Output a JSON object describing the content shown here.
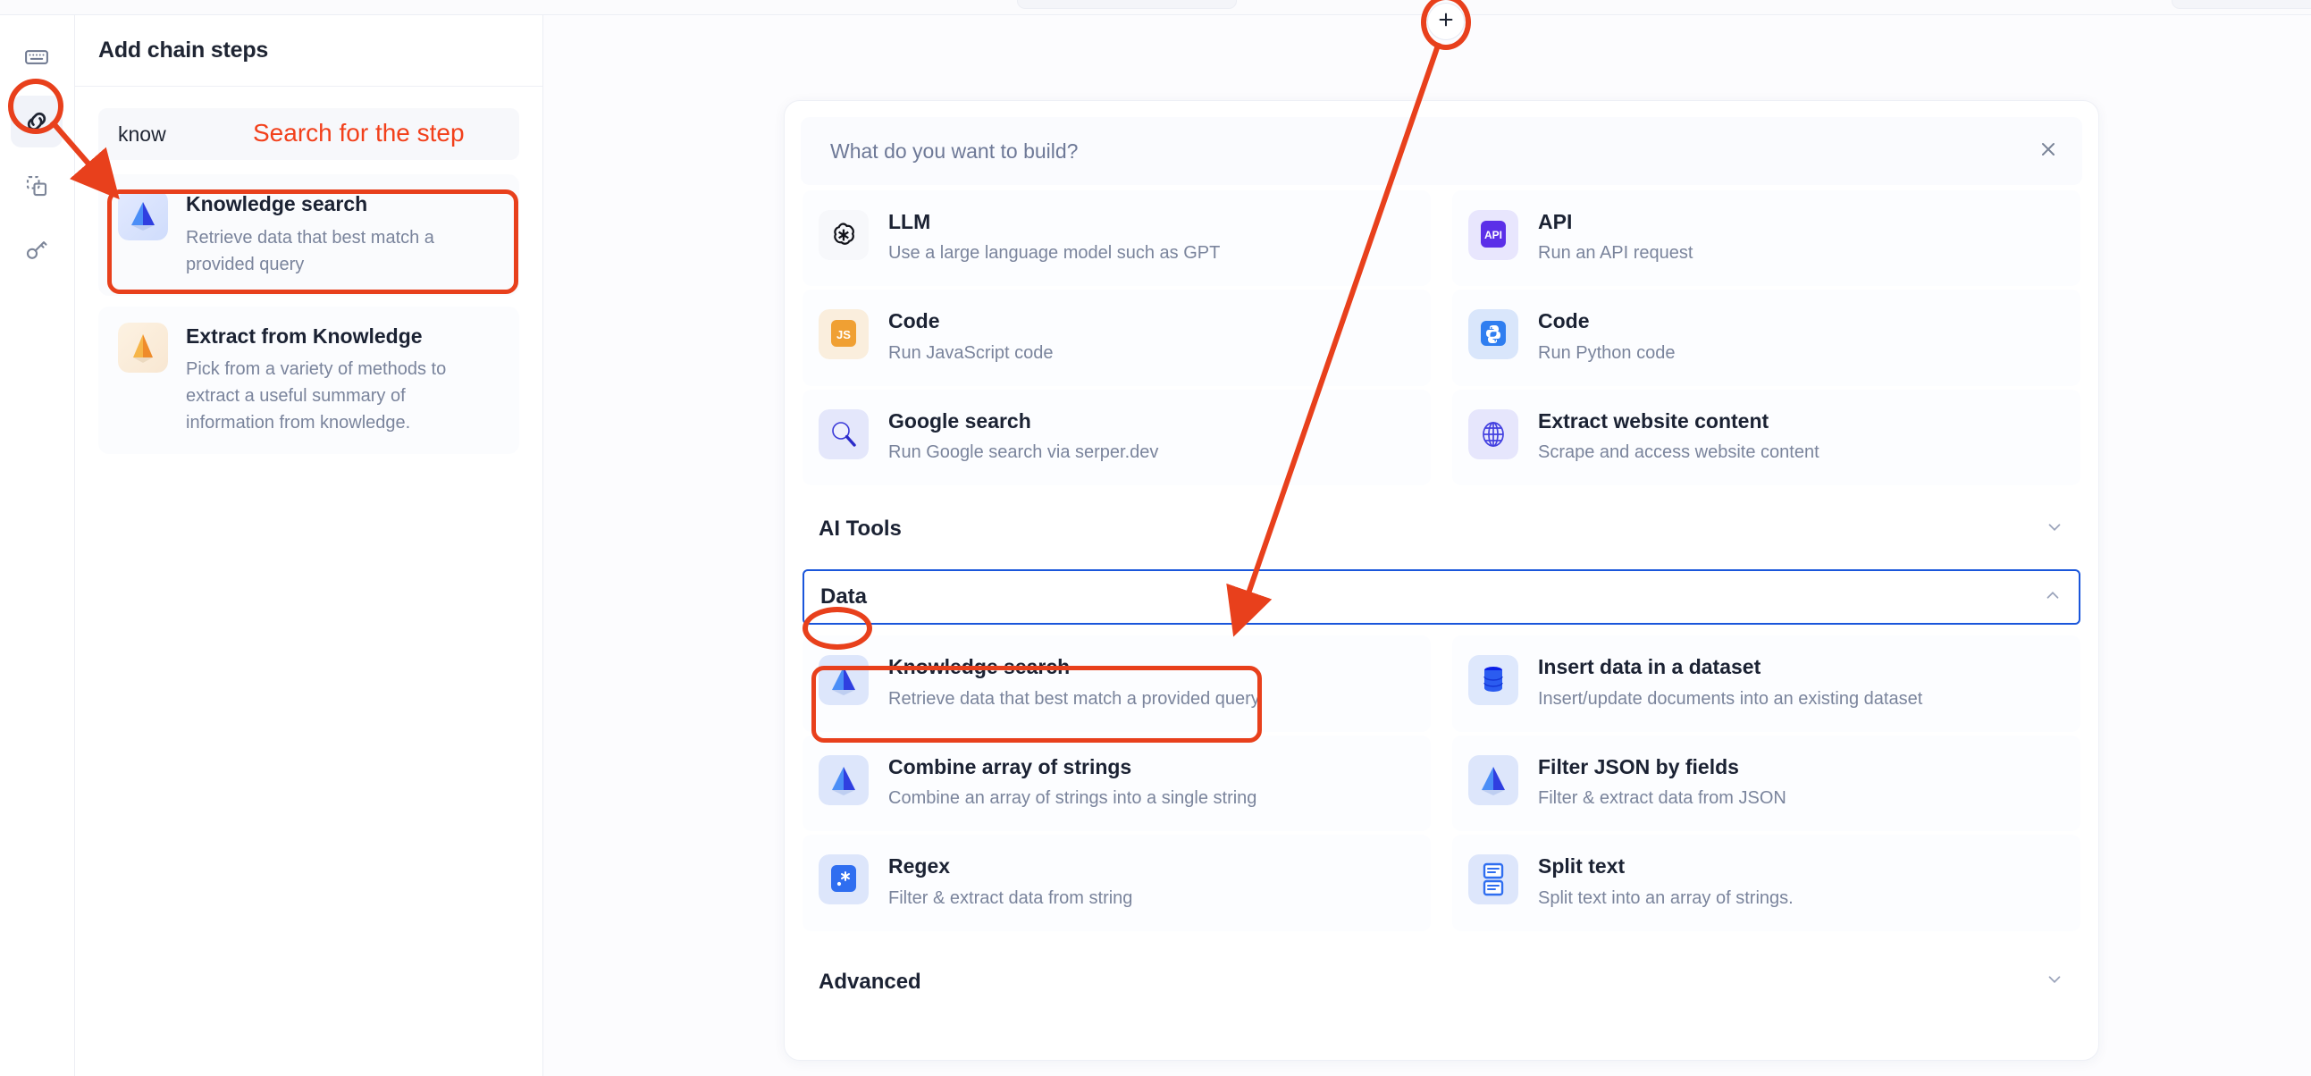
{
  "app": {
    "accent_red": "#e8401c",
    "accent_blue": "#1a56db"
  },
  "left_panel": {
    "title": "Add chain steps",
    "search": {
      "value": "know",
      "placeholder": "Search for the step"
    },
    "results": [
      {
        "title": "Knowledge search",
        "desc": "Retrieve data that best match a provided query",
        "icon": "blue-pyramid-icon",
        "highlighted": true
      },
      {
        "title": "Extract from Knowledge",
        "desc": "Pick from a variety of methods to extract a useful summary of information from knowledge.",
        "icon": "orange-pyramid-icon",
        "highlighted": false
      }
    ]
  },
  "rail": {
    "items": [
      {
        "name": "keyboard-input-icon",
        "active": false
      },
      {
        "name": "chain-link-icon",
        "active": true
      },
      {
        "name": "duplicate-frame-icon",
        "active": false
      },
      {
        "name": "key-icon",
        "active": false
      }
    ]
  },
  "modal": {
    "heading": "What do you want to build?",
    "close_label": "✕",
    "top_tiles": [
      {
        "title": "LLM",
        "desc": "Use a large language model such as GPT",
        "icon": "openai-icon"
      },
      {
        "title": "API",
        "desc": "Run an API request",
        "icon": "api-icon"
      },
      {
        "title": "Code",
        "desc": "Run JavaScript code",
        "icon": "javascript-icon"
      },
      {
        "title": "Code",
        "desc": "Run Python code",
        "icon": "python-icon"
      },
      {
        "title": "Google search",
        "desc": "Run Google search via serper.dev",
        "icon": "magnifier-icon"
      },
      {
        "title": "Extract website content",
        "desc": "Scrape and access website content",
        "icon": "globe-icon"
      }
    ],
    "sections": [
      {
        "title": "AI Tools",
        "expanded": false,
        "chevron": "chevron-down-icon"
      },
      {
        "title": "Data",
        "expanded": true,
        "chevron": "chevron-up-icon"
      },
      {
        "title": "Advanced",
        "expanded": false,
        "chevron": "chevron-down-icon"
      }
    ],
    "data_tiles": [
      {
        "title": "Knowledge search",
        "desc": "Retrieve data that best match a provided query",
        "icon": "blue-pyramid-icon",
        "highlighted": true
      },
      {
        "title": "Insert data in a dataset",
        "desc": "Insert/update documents into an existing dataset",
        "icon": "database-icon",
        "highlighted": false
      },
      {
        "title": "Combine array of strings",
        "desc": "Combine an array of strings into a single string",
        "icon": "blue-pyramid-icon",
        "highlighted": false
      },
      {
        "title": "Filter JSON by fields",
        "desc": "Filter & extract data from JSON",
        "icon": "blue-pyramid-icon",
        "highlighted": false
      },
      {
        "title": "Regex",
        "desc": "Filter & extract data from string",
        "icon": "regex-icon",
        "highlighted": false
      },
      {
        "title": "Split text",
        "desc": "Split text into an array of strings.",
        "icon": "split-text-icon",
        "highlighted": false
      }
    ]
  },
  "annotations": {
    "search_hint": "Search for the step",
    "plus_button_label": "+"
  }
}
